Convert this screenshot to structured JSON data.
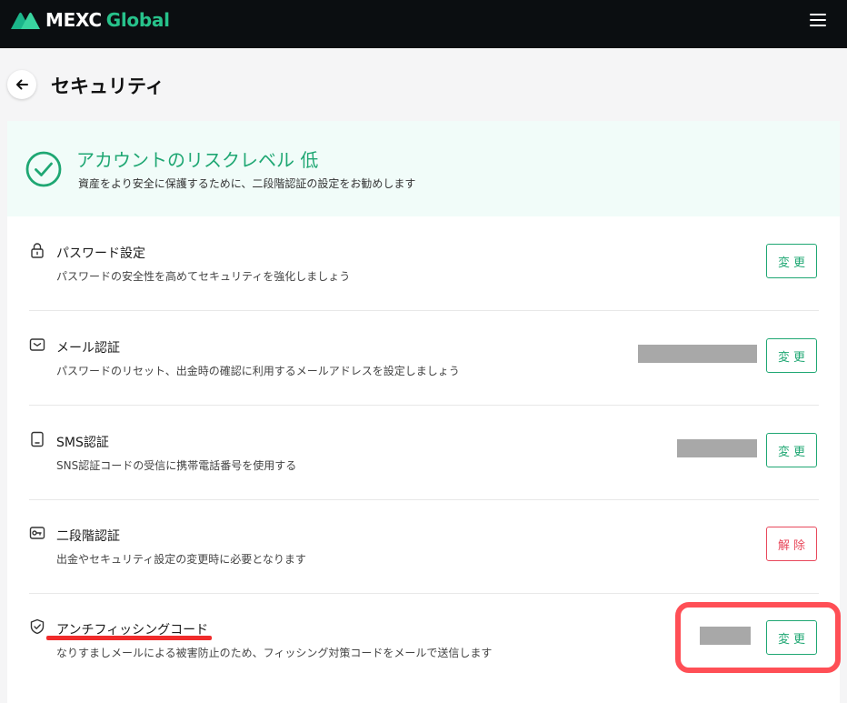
{
  "brand": {
    "name_primary": "MEXC",
    "name_secondary": "Global",
    "accent_color": "#27c28b"
  },
  "header": {
    "menu_icon": "hamburger-menu-icon"
  },
  "page": {
    "back_icon": "arrow-left-icon",
    "title": "セキュリティ"
  },
  "risk": {
    "icon": "check-circle-icon",
    "title": "アカウントのリスクレベル 低",
    "description": "資産をより安全に保護するために、二段階認証の設定をお勧めします"
  },
  "settings": [
    {
      "icon": "lock-icon",
      "title": "パスワード設定",
      "description": "パスワードの安全性を高めてセキュリティを強化しましょう",
      "action": "変更",
      "action_type": "primary",
      "has_redacted_value": false
    },
    {
      "icon": "mail-icon",
      "title": "メール認証",
      "description": "パスワードのリセット、出金時の確認に利用するメールアドレスを設定しましょう",
      "action": "変更",
      "action_type": "primary",
      "has_redacted_value": true
    },
    {
      "icon": "phone-icon",
      "title": "SMS認証",
      "description": "SNS認証コードの受信に携帯電話番号を使用する",
      "action": "変更",
      "action_type": "primary",
      "has_redacted_value": true
    },
    {
      "icon": "key-icon",
      "title": "二段階認証",
      "description": "出金やセキュリティ設定の変更時に必要となります",
      "action": "解除",
      "action_type": "danger",
      "has_redacted_value": false
    },
    {
      "icon": "shield-check-icon",
      "title": "アンチフィッシングコード",
      "description": "なりすましメールによる被害防止のため、フィッシング対策コードをメールで送信します",
      "action": "変更",
      "action_type": "primary",
      "has_redacted_value": true
    }
  ],
  "colors": {
    "success": "#1fa773",
    "danger": "#e8495c",
    "annotation": "#ff4f56"
  }
}
